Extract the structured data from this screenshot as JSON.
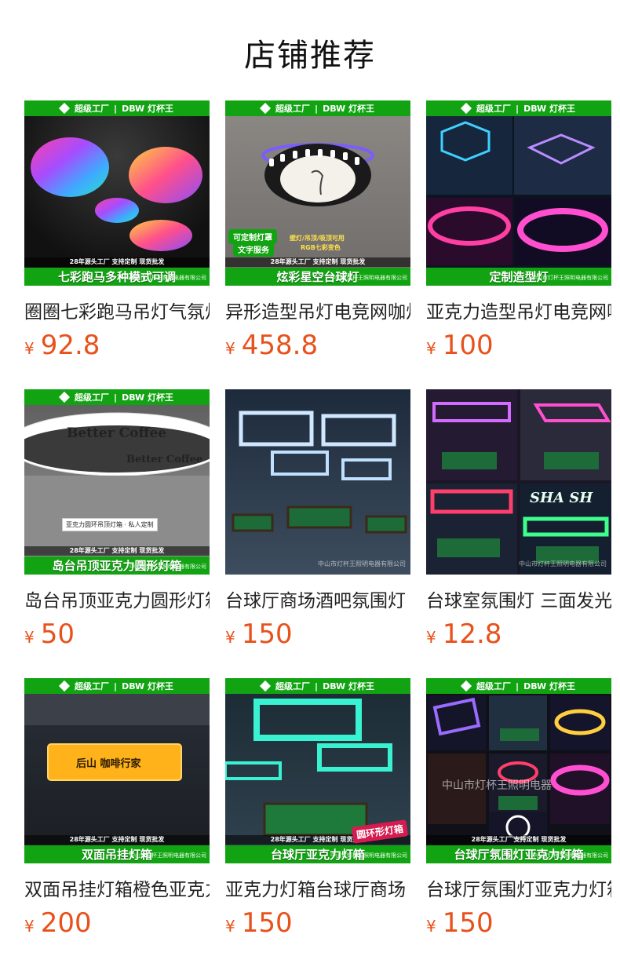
{
  "page_title": "店铺推荐",
  "banner": {
    "brand_left": "超级工厂",
    "brand_right": "DBW 灯杯王",
    "slogan": "28年源头工厂 支持定制 现货批发",
    "company": "中山市灯杯王照明电器有限公司"
  },
  "currency": "¥",
  "products": [
    {
      "name": "圈圈七彩跑马吊灯气氛灯",
      "price": "92.8",
      "caption": "七彩跑马多种模式可调",
      "company": "中山市灯杯王照明电器有限公司"
    },
    {
      "name": "异形造型吊灯电竞网咖灯",
      "price": "458.8",
      "caption": "炫彩星空台球灯",
      "company": "中山市灯杯王照明电器有限公司",
      "badges": [
        "可定制灯罩",
        "文字服务"
      ],
      "note_lines": [
        "壁灯/吊顶/吸顶可用",
        "RGB七彩变色"
      ]
    },
    {
      "name": "亚克力造型吊灯电竞网咖",
      "price": "100",
      "caption": "定制造型灯",
      "company": "中山市灯杯王照明电器有限公司"
    },
    {
      "name": "岛台吊顶亚克力圆形灯箱",
      "price": "50",
      "caption": "岛台吊顶亚克力圆形灯箱",
      "company": "中山市灯杯王照明电器有限公司",
      "sign_text": "Better Coffee",
      "label": "亚克力圆环吊顶灯箱 · 私人定制"
    },
    {
      "name": "台球厅商场酒吧氛围灯",
      "price": "150",
      "watermark": "中山市灯杯王照明电器有限公司"
    },
    {
      "name": "台球室氛围灯 三面发光",
      "price": "12.8",
      "watermark": "中山市灯杯王照明电器有限公司",
      "sign_text": "SHA SH"
    },
    {
      "name": "双面吊挂灯箱橙色亚克力",
      "price": "200",
      "caption": "双面吊挂灯箱",
      "company": "中山市灯杯王照明电器有限公司",
      "sign_text": "后山 咖啡行家"
    },
    {
      "name": "亚克力灯箱台球厅商场",
      "price": "150",
      "caption": "台球厅亚克力灯箱",
      "company": "中山市灯杯王照明电器有限公司",
      "pink_tag": "圆环形灯箱"
    },
    {
      "name": "台球厅氛围灯亚克力灯箱",
      "price": "150",
      "caption": "台球厅氛围灯亚克力灯箱",
      "company": "中山市灯杯王照明电器有限公司",
      "watermark": "中山市灯杯王照明电器"
    }
  ]
}
